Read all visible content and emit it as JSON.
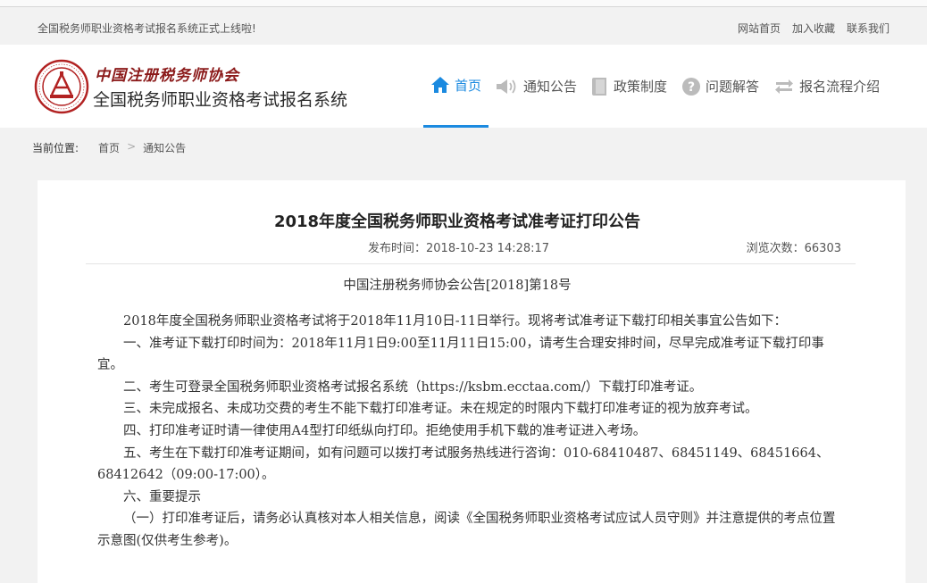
{
  "topbar": {
    "notice": "全国税务师职业资格考试报名系统正式上线啦!",
    "links": [
      "网站首页",
      "加入收藏",
      "联系我们"
    ]
  },
  "header": {
    "org_name": "中国注册税务师协会",
    "system_name": "全国税务师职业资格考试报名系统"
  },
  "nav": [
    {
      "label": "首页",
      "icon": "home-icon",
      "active": true
    },
    {
      "label": "通知公告",
      "icon": "speaker-icon",
      "active": false
    },
    {
      "label": "政策制度",
      "icon": "book-icon",
      "active": false
    },
    {
      "label": "问题解答",
      "icon": "question-icon",
      "active": false
    },
    {
      "label": "报名流程介绍",
      "icon": "process-icon",
      "active": false
    }
  ],
  "breadcrumb": {
    "label": "当前位置:",
    "items": [
      "首页",
      "通知公告"
    ],
    "separator": ">"
  },
  "article": {
    "title": "2018年度全国税务师职业资格考试准考证打印公告",
    "published": "发布时间：2018-10-23 14:28:17",
    "views": "浏览次数：66303",
    "doc_number": "中国注册税务师协会公告[2018]第18号",
    "paragraphs": [
      "2018年度全国税务师职业资格考试将于2018年11月10日-11日举行。现将考试准考证下载打印相关事宜公告如下：",
      "一、准考证下载打印时间为：2018年11月1日9:00至11月11日15:00，请考生合理安排时间，尽早完成准考证下载打印事宜。",
      "二、考生可登录全国税务师职业资格考试报名系统（https://ksbm.ecctaa.com/）下载打印准考证。",
      "三、未完成报名、未成功交费的考生不能下载打印准考证。未在规定的时限内下载打印准考证的视为放弃考试。",
      "四、打印准考证时请一律使用A4型打印纸纵向打印。拒绝使用手机下载的准考证进入考场。",
      "五、考生在下载打印准考证期间，如有问题可以拨打考试服务热线进行咨询：010-68410487、68451149、68451664、68412642（09:00-17:00）。",
      "六、重要提示",
      "（一）打印准考证后，请务必认真核对本人相关信息，阅读《全国税务师职业资格考试应试人员守则》并注意提供的考点位置示意图(仅供考生参考)。"
    ]
  },
  "colors": {
    "accent": "#1b8ae0",
    "logo_red": "#b22222"
  }
}
